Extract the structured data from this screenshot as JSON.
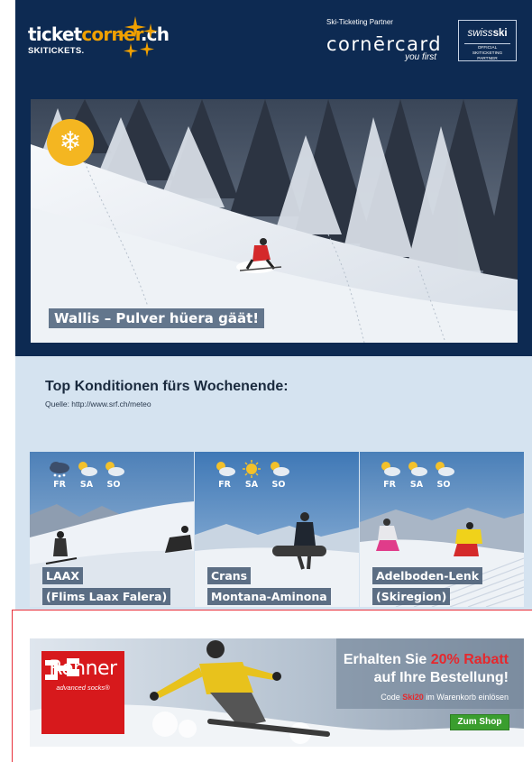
{
  "header": {
    "logo_prefix": "ticket",
    "logo_highlight": "corner",
    "logo_suffix": ".ch",
    "logo_sub": "SKITICKETS.",
    "partner_label": "Ski-Ticketing Partner",
    "cornercard": "cornērcard",
    "cornercard_tagline": "you first",
    "swiss_prefix": "swiss",
    "swiss_bold": "ski",
    "swiss_sub": "OFFICIAL SKITICKETING PARTNER"
  },
  "hero": {
    "icon": "snowflake-icon",
    "caption": "Wallis – Pulver hüera gäät!"
  },
  "section": {
    "title": "Top Konditionen fürs Wochenende:",
    "source": "Quelle: http://www.srf.ch/meteo"
  },
  "tiles": [
    {
      "days": [
        {
          "label": "FR",
          "icon": "snow-cloud-icon"
        },
        {
          "label": "SA",
          "icon": "partly-sunny-icon"
        },
        {
          "label": "SO",
          "icon": "partly-sunny-icon"
        }
      ],
      "caption_line1": "LAAX",
      "caption_line2": "(Flims Laax Falera)"
    },
    {
      "days": [
        {
          "label": "FR",
          "icon": "partly-sunny-icon"
        },
        {
          "label": "SA",
          "icon": "sunny-icon"
        },
        {
          "label": "SO",
          "icon": "partly-sunny-icon"
        }
      ],
      "caption_line1": "Crans",
      "caption_line2": "Montana-Aminona"
    },
    {
      "days": [
        {
          "label": "FR",
          "icon": "partly-sunny-icon"
        },
        {
          "label": "SA",
          "icon": "partly-sunny-icon"
        },
        {
          "label": "SO",
          "icon": "partly-sunny-icon"
        }
      ],
      "caption_line1": "Adelboden-Lenk",
      "caption_line2": "(Skiregion)"
    }
  ],
  "banner": {
    "brand": "Rohner",
    "brand_sub": "advanced socks®",
    "offer_prefix": "Erhalten Sie ",
    "offer_percent": "20% Rabatt",
    "offer_line2": "auf Ihre Bestellung!",
    "code_prefix": "Code ",
    "code": "Ski20",
    "code_suffix": " im Warenkorb einlösen",
    "shop_button": "Zum Shop"
  },
  "colors": {
    "header_bg": "#0d2a52",
    "logo_accent": "#f0a000",
    "section_bg": "#d5e3f0",
    "brand_red": "#d7191c",
    "shop_green": "#3a9e2e"
  }
}
